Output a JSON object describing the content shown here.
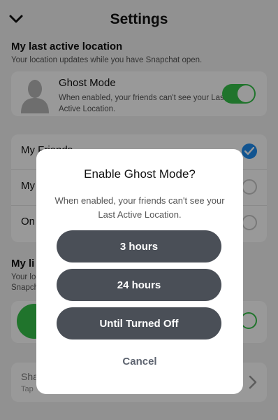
{
  "header": {
    "title": "Settings",
    "back_icon": "chevron-down-icon"
  },
  "last_active": {
    "title": "My last active location",
    "subtitle": "Your location updates while you have Snapchat open."
  },
  "ghost_mode": {
    "title": "Ghost Mode",
    "description": "When enabled, your friends can't see your Last Active Location.",
    "enabled": true,
    "accent": "#36c24a"
  },
  "friends_options": [
    {
      "label": "My Friends",
      "selected": true
    },
    {
      "label": "My",
      "selected": false
    },
    {
      "label": "On",
      "selected": false
    }
  ],
  "live_section": {
    "title": "My li",
    "line1": "Your lo",
    "line2": "Snapch"
  },
  "share": {
    "label": "Sha",
    "sub": "Tap"
  },
  "dialog": {
    "title": "Enable Ghost Mode?",
    "message": "When enabled, your friends can't see your Last Active Location.",
    "options": [
      "3 hours",
      "24 hours",
      "Until Turned Off"
    ],
    "cancel": "Cancel"
  },
  "colors": {
    "selected_radio": "#1e8cf0",
    "button_bg": "#4a4f57"
  }
}
